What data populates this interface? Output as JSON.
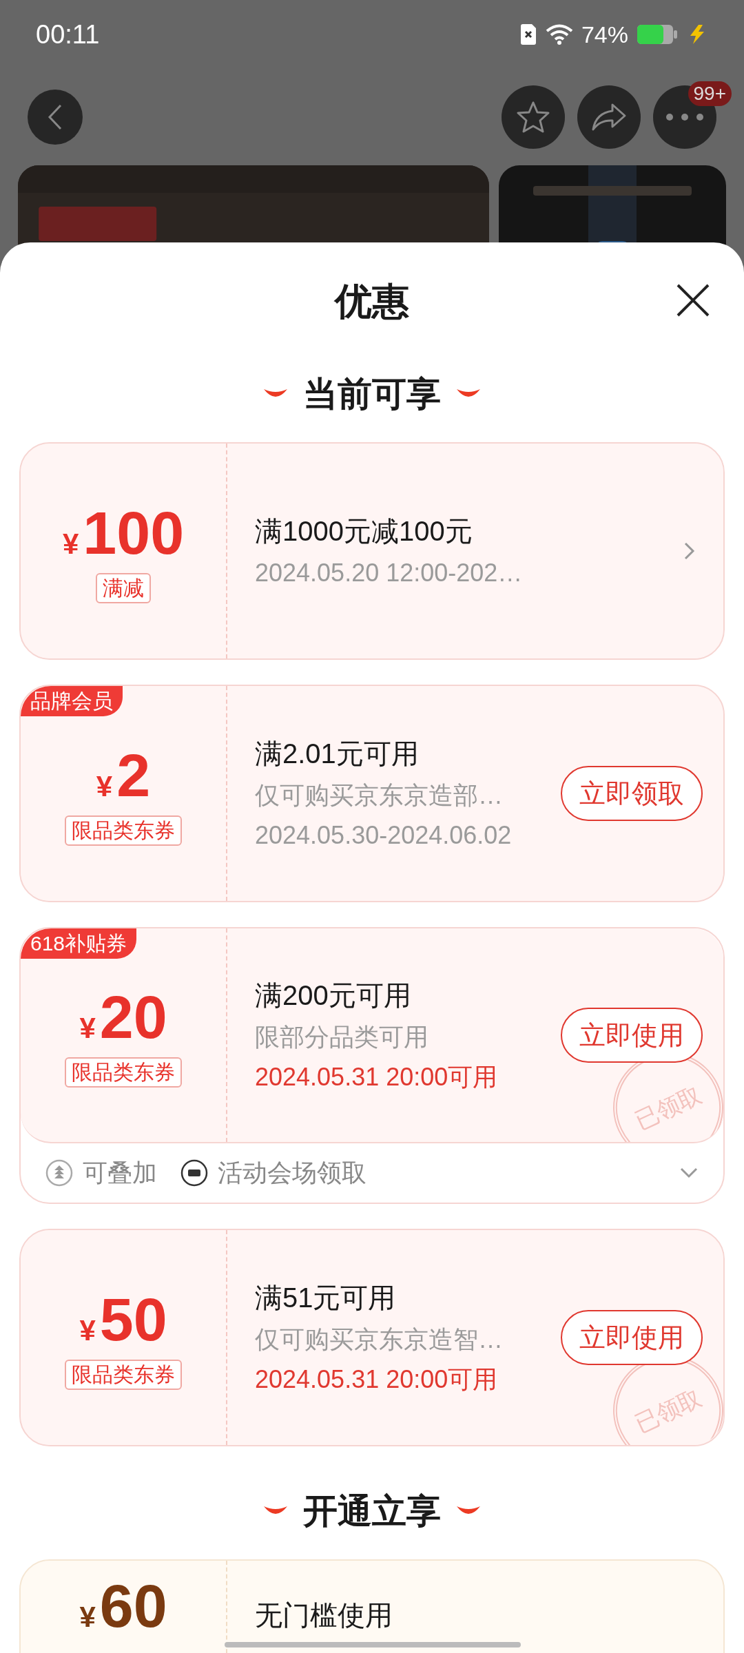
{
  "status_bar": {
    "time": "00:11",
    "battery_text": "74%"
  },
  "toolbar": {
    "badge": "99+"
  },
  "sheet": {
    "title": "优惠",
    "sections": [
      {
        "title": "当前可享",
        "coupons": [
          {
            "kind": "red",
            "currency": "¥",
            "amount": "100",
            "tag": "满减",
            "title": "满1000元减100元",
            "details": [
              {
                "text": "2024.05.20 12:00-202…",
                "highlight": false
              }
            ],
            "chevron": true
          },
          {
            "kind": "red",
            "badge": "品牌会员",
            "currency": "¥",
            "amount": "2",
            "tag": "限品类东券",
            "title": "满2.01元可用",
            "details": [
              {
                "text": "仅可购买京东京造部…",
                "highlight": false
              },
              {
                "text": "2024.05.30-2024.06.02",
                "highlight": false
              }
            ],
            "button": "立即领取",
            "chevron": false
          },
          {
            "kind": "red",
            "badge": "618补贴券",
            "currency": "¥",
            "amount": "20",
            "tag": "限品类东券",
            "title": "满200元可用",
            "details": [
              {
                "text": "限部分品类可用",
                "highlight": false
              },
              {
                "text": "2024.05.31 20:00可用",
                "highlight": true
              }
            ],
            "button": "立即使用",
            "stamp": "已领取",
            "chevron": false,
            "footer": [
              {
                "kind": "stack",
                "text": "可叠加"
              },
              {
                "kind": "ticket",
                "text": "活动会场领取"
              }
            ]
          },
          {
            "kind": "red",
            "currency": "¥",
            "amount": "50",
            "tag": "限品类东券",
            "title": "满51元可用",
            "details": [
              {
                "text": "仅可购买京东京造智…",
                "highlight": false
              },
              {
                "text": "2024.05.31 20:00可用",
                "highlight": true
              }
            ],
            "button": "立即使用",
            "stamp": "已领取",
            "chevron": false
          }
        ]
      },
      {
        "title": "开通立享",
        "coupons": [
          {
            "kind": "member",
            "currency": "¥",
            "amount": "60",
            "title": "无门槛使用",
            "chevron": false
          }
        ]
      }
    ]
  }
}
